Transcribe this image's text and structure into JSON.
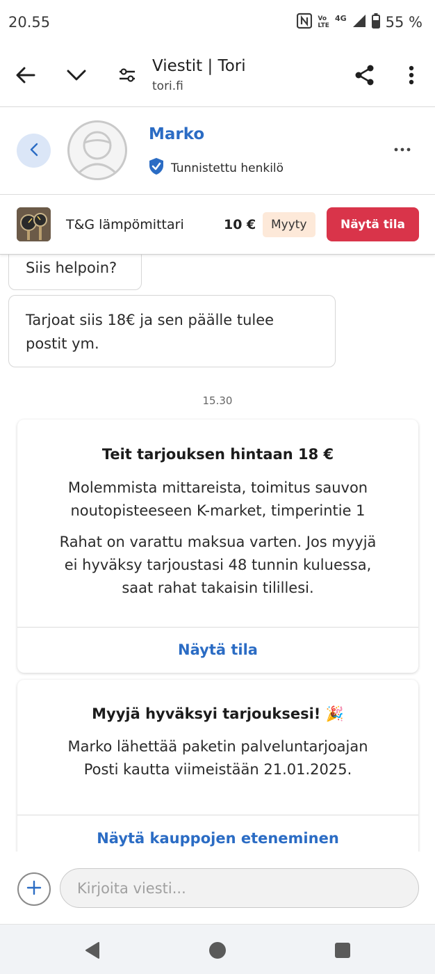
{
  "status_bar": {
    "time": "20.55",
    "battery_percent": "55 %",
    "network": "4G",
    "volte_label_top": "Vo",
    "volte_label_bottom": "LTE",
    "icons": [
      "nfc-icon",
      "volte-icon",
      "signal-icon",
      "battery-icon"
    ]
  },
  "browser": {
    "title": "Viestit | Tori",
    "url": "tori.fi",
    "icons": [
      "back-arrow-icon",
      "chevron-down-icon",
      "tune-icon",
      "share-icon",
      "more-vert-icon"
    ]
  },
  "profile": {
    "name": "Marko",
    "verified_label": "Tunnistettu henkilö",
    "accent_color": "#2b6cc4"
  },
  "listing": {
    "title": "T&G lämpömittari",
    "price": "10 €",
    "status_badge": "Myyty",
    "action_button": "Näytä tila",
    "action_color": "#d9344a"
  },
  "chat": {
    "messages": [
      {
        "text": "Siis helpoin?"
      },
      {
        "line1": "Tarjoat siis 18€ ja sen päälle tulee",
        "line2": "postit ym."
      }
    ],
    "timestamp": "15.30",
    "offer_card": {
      "title": "Teit tarjouksen hintaan 18 €",
      "detail_line1": "Molemmista mittareista, toimitus sauvon",
      "detail_line2": "noutopisteeseen K-market, timperintie 1",
      "info_line1": "Rahat on varattu maksua varten. Jos myyjä",
      "info_line2": "ei hyväksy tarjoustasi 48 tunnin kuluessa,",
      "info_line3": "saat rahat takaisin tilillesi.",
      "link": "Näytä tila"
    },
    "accepted_card": {
      "title": "Myyjä hyväksyi tarjouksesi! 🎉",
      "text_line1": "Marko lähettää paketin palveluntarjoajan",
      "text_line2": "Posti kautta viimeistään 21.01.2025.",
      "link": "Näytä kauppojen eteneminen"
    }
  },
  "composer": {
    "placeholder": "Kirjoita viesti..."
  }
}
